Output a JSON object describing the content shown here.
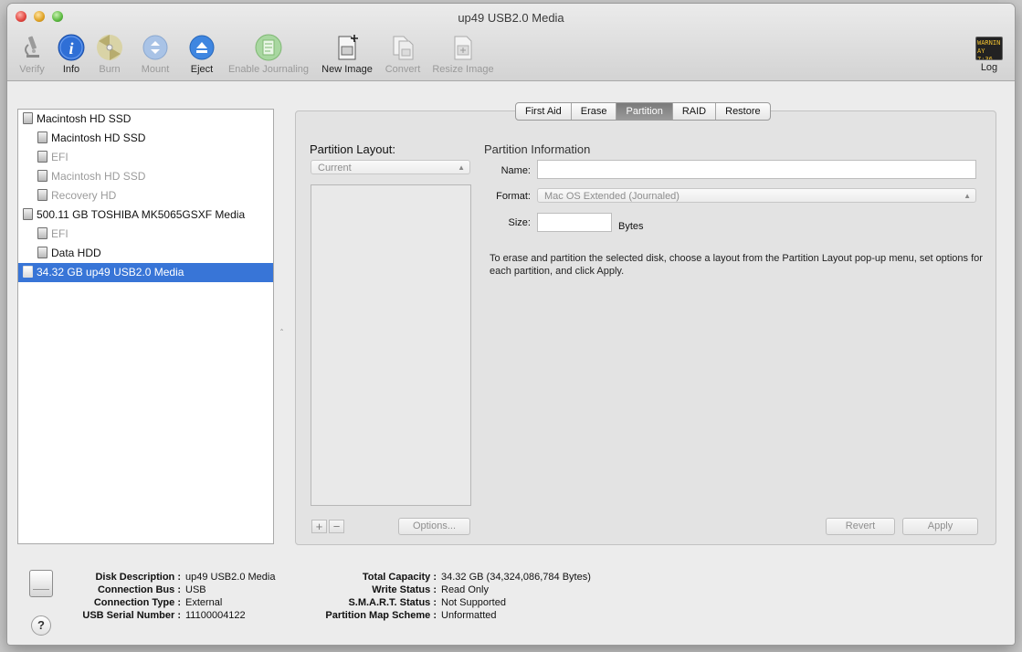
{
  "window": {
    "title": "up49 USB2.0 Media"
  },
  "toolbar": {
    "verify": "Verify",
    "info": "Info",
    "burn": "Burn",
    "mount": "Mount",
    "eject": "Eject",
    "enable_journaling": "Enable Journaling",
    "new_image": "New Image",
    "convert": "Convert",
    "resize_image": "Resize Image",
    "log": "Log",
    "log_icon_text_1": "WARNIN",
    "log_icon_text_2": "AY 7:36"
  },
  "sidebar": {
    "items": [
      {
        "label": "Macintosh HD SSD",
        "level": 0,
        "state": "normal"
      },
      {
        "label": "Macintosh HD SSD",
        "level": 1,
        "state": "normal"
      },
      {
        "label": "EFI",
        "level": 1,
        "state": "dimmed"
      },
      {
        "label": "Macintosh HD SSD",
        "level": 1,
        "state": "dimmed"
      },
      {
        "label": "Recovery HD",
        "level": 1,
        "state": "dimmed"
      },
      {
        "label": "500.11 GB TOSHIBA MK5065GSXF Media",
        "level": 0,
        "state": "normal"
      },
      {
        "label": "EFI",
        "level": 1,
        "state": "dimmed"
      },
      {
        "label": "Data HDD",
        "level": 1,
        "state": "normal"
      },
      {
        "label": "34.32 GB up49 USB2.0 Media",
        "level": 0,
        "state": "selected"
      }
    ]
  },
  "tabs": [
    "First Aid",
    "Erase",
    "Partition",
    "RAID",
    "Restore"
  ],
  "active_tab": "Partition",
  "partition_layout": {
    "title": "Partition Layout:",
    "selected": "Current",
    "add_label": "+",
    "remove_label": "−",
    "options_label": "Options..."
  },
  "partition_info": {
    "title": "Partition Information",
    "name_label": "Name:",
    "name_value": "",
    "format_label": "Format:",
    "format_value": "Mac OS Extended (Journaled)",
    "size_label": "Size:",
    "size_value": "",
    "size_units": "Bytes",
    "help": "To erase and partition the selected disk, choose a layout from the Partition Layout pop-up menu, set options for each partition, and click Apply.",
    "revert_label": "Revert",
    "apply_label": "Apply"
  },
  "disk_info": {
    "left": [
      {
        "key": "Disk Description :",
        "value": "up49 USB2.0 Media"
      },
      {
        "key": "Connection Bus :",
        "value": "USB"
      },
      {
        "key": "Connection Type :",
        "value": "External"
      },
      {
        "key": "USB Serial Number :",
        "value": "11100004122"
      }
    ],
    "right": [
      {
        "key": "Total Capacity :",
        "value": "34.32 GB (34,324,086,784 Bytes)"
      },
      {
        "key": "Write Status :",
        "value": "Read Only"
      },
      {
        "key": "S.M.A.R.T. Status :",
        "value": "Not Supported"
      },
      {
        "key": "Partition Map Scheme :",
        "value": "Unformatted"
      }
    ]
  },
  "help_button_label": "?",
  "colors": {
    "selection": "#3875d7",
    "info_blue": "#2f6fd6"
  }
}
